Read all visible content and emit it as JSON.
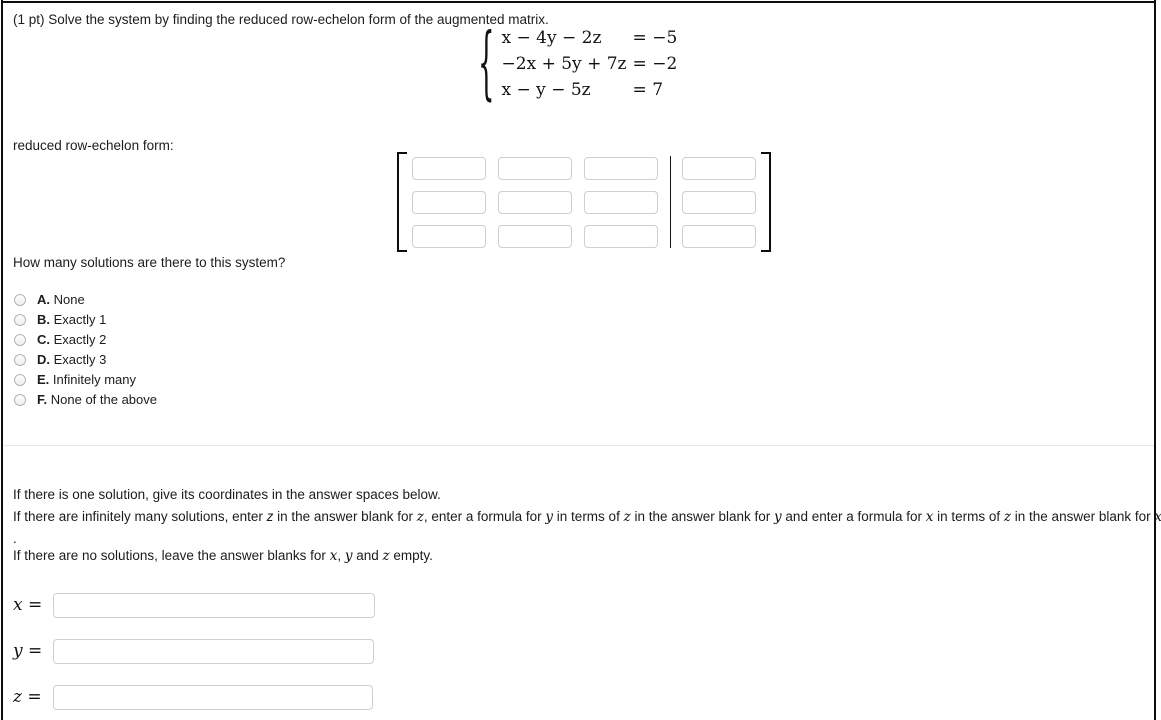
{
  "problem": {
    "points_label": "(1 pt)",
    "prompt": "Solve the system by finding the reduced row-echelon form of the augmented matrix.",
    "prompt_full": "(1 pt) Solve the system by finding the reduced row-echelon form of the augmented matrix."
  },
  "system": {
    "brace": "{",
    "equations": [
      {
        "lhs": "x − 4y − 2z",
        "rhs": "= −5"
      },
      {
        "lhs": "−2x + 5y + 7z",
        "rhs": "= −2"
      },
      {
        "lhs": "x − y − 5z",
        "rhs": "= 7"
      }
    ]
  },
  "rref": {
    "label": "reduced row-echelon form:",
    "left_bracket": "[",
    "right_bracket": "]",
    "rows": 3,
    "cols": 4,
    "augment_after_col": 3,
    "cells": [
      [
        "",
        "",
        "",
        ""
      ],
      [
        "",
        "",
        "",
        ""
      ],
      [
        "",
        "",
        "",
        ""
      ]
    ]
  },
  "question": {
    "text": "How many solutions are there to this system?",
    "choices": [
      {
        "letter": "A.",
        "label": "None",
        "selected": false
      },
      {
        "letter": "B.",
        "label": "Exactly 1",
        "selected": false
      },
      {
        "letter": "C.",
        "label": "Exactly 2",
        "selected": false
      },
      {
        "letter": "D.",
        "label": "Exactly 3",
        "selected": false
      },
      {
        "letter": "E.",
        "label": "Infinitely many",
        "selected": false
      },
      {
        "letter": "F.",
        "label": "None of the above",
        "selected": false
      }
    ]
  },
  "instructions": {
    "line1": "If there is one solution, give its coordinates in the answer spaces below.",
    "line2_a": "If there are infinitely many solutions, enter ",
    "line2_z_plain": "z",
    "line2_b": " in the answer blank for ",
    "line2_z1": "z",
    "line2_c": ", enter a formula for ",
    "line2_y": "y",
    "line2_d": " in terms of ",
    "line2_z2": "z",
    "line2_e": " in the answer blank for ",
    "line2_y2": "y",
    "line2_f": " and enter a formula for ",
    "line2_x": "x",
    "line2_g": " in terms of ",
    "line2_z3": "z",
    "line2_h": " in the answer blank for ",
    "line2_x2": "x",
    "line3": ".",
    "line4_a": "If there are no solutions, leave the answer blanks for ",
    "line4_x": "x",
    "line4_comma": ", ",
    "line4_y": "y",
    "line4_and": " and ",
    "line4_z": "z",
    "line4_end": " empty."
  },
  "answers": [
    {
      "var": "x",
      "eq": "=",
      "value": "",
      "placeholder": ""
    },
    {
      "var": "y",
      "eq": "=",
      "value": "",
      "placeholder": ""
    },
    {
      "var": "z",
      "eq": "=",
      "value": "",
      "placeholder": ""
    }
  ],
  "colors": {
    "text": "#1c1c1c",
    "math": "#111111",
    "field_border": "#cfcfcf",
    "divider": "#e6e6e6",
    "frame": "#0d0d0d",
    "background": "#ffffff"
  }
}
